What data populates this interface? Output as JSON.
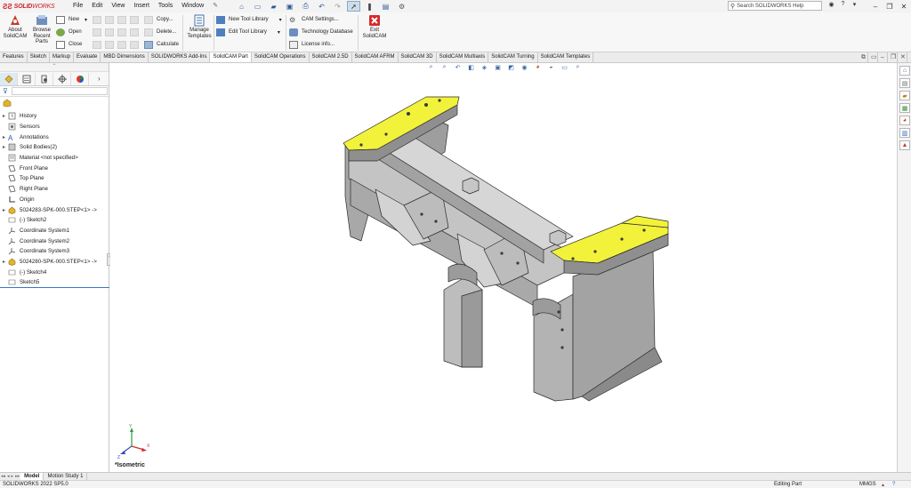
{
  "app": {
    "logo_solid": "SOLID",
    "logo_works": "WORKS"
  },
  "menu": [
    "File",
    "Edit",
    "View",
    "Insert",
    "Tools",
    "Window"
  ],
  "search": {
    "placeholder": "Search SOLIDWORKS Help"
  },
  "ribbon": {
    "about": "About SolidCAM",
    "browse": "Browse Recent Parts",
    "new": "New",
    "open": "Open",
    "close": "Close",
    "copy": "Copy...",
    "delete": "Delete...",
    "calculate": "Calculate",
    "manage": "Manage Templates",
    "new_tool_library": "New Tool Library",
    "edit_tool_library": "Edit Tool Library",
    "cam_settings": "CAM Settings...",
    "technology_database": "Technology Database",
    "license_info": "License info...",
    "exit": "Exit SolidCAM"
  },
  "command_tabs": [
    "Features",
    "Sketch",
    "Markup",
    "Evaluate",
    "MBD Dimensions",
    "SOLIDWORKS Add-Ins",
    "SolidCAM Part",
    "SolidCAM Operations",
    "SolidCAM 2.5D",
    "SolidCAM AFRM",
    "SolidCAM 3D",
    "SolidCAM Multiaxis",
    "SolidCAM Turning",
    "SolidCAM Templates"
  ],
  "active_command_tab": "SolidCAM Part",
  "tree": [
    {
      "label": "History",
      "icon": "history-icon",
      "expand": true
    },
    {
      "label": "Sensors",
      "icon": "sensors-icon",
      "expand": false
    },
    {
      "label": "Annotations",
      "icon": "annotations-icon",
      "expand": true
    },
    {
      "label": "Solid Bodies(2)",
      "icon": "solid-bodies-icon",
      "expand": true
    },
    {
      "label": "Material <not specified>",
      "icon": "material-icon",
      "expand": false
    },
    {
      "label": "Front Plane",
      "icon": "plane-icon",
      "expand": false
    },
    {
      "label": "Top Plane",
      "icon": "plane-icon",
      "expand": false
    },
    {
      "label": "Right Plane",
      "icon": "plane-icon",
      "expand": false
    },
    {
      "label": "Origin",
      "icon": "origin-icon",
      "expand": false
    },
    {
      "label": "5024283-SPK-000.STEP<1> ->",
      "icon": "part-icon",
      "expand": true
    },
    {
      "label": "(-) Sketch2",
      "icon": "sketch-icon",
      "expand": false
    },
    {
      "label": "Coordinate System1",
      "icon": "coordinate-system-icon",
      "expand": false
    },
    {
      "label": "Coordinate System2",
      "icon": "coordinate-system-icon",
      "expand": false
    },
    {
      "label": "Coordinate System3",
      "icon": "coordinate-system-icon",
      "expand": false
    },
    {
      "label": "5024280-SPK-000.STEP<1> ->",
      "icon": "part-icon",
      "expand": true
    },
    {
      "label": "(-) Sketch4",
      "icon": "sketch-icon",
      "expand": false
    },
    {
      "label": "Sketch5",
      "icon": "sketch-icon",
      "expand": false
    }
  ],
  "viewport": {
    "view_name": "*Isometric",
    "triad": {
      "x": "X",
      "y": "Y",
      "z": "Z"
    }
  },
  "bottom_tabs": [
    "Model",
    "Motion Study 1"
  ],
  "active_bottom_tab": "Model",
  "status": {
    "version": "SOLIDWORKS 2022 SP5.0",
    "mode": "Editing Part",
    "units": "MMGS"
  },
  "colors": {
    "accent": "#3a78c4",
    "highlight_faces": "#f2f23a",
    "model_grey": "#b9b9b9"
  }
}
